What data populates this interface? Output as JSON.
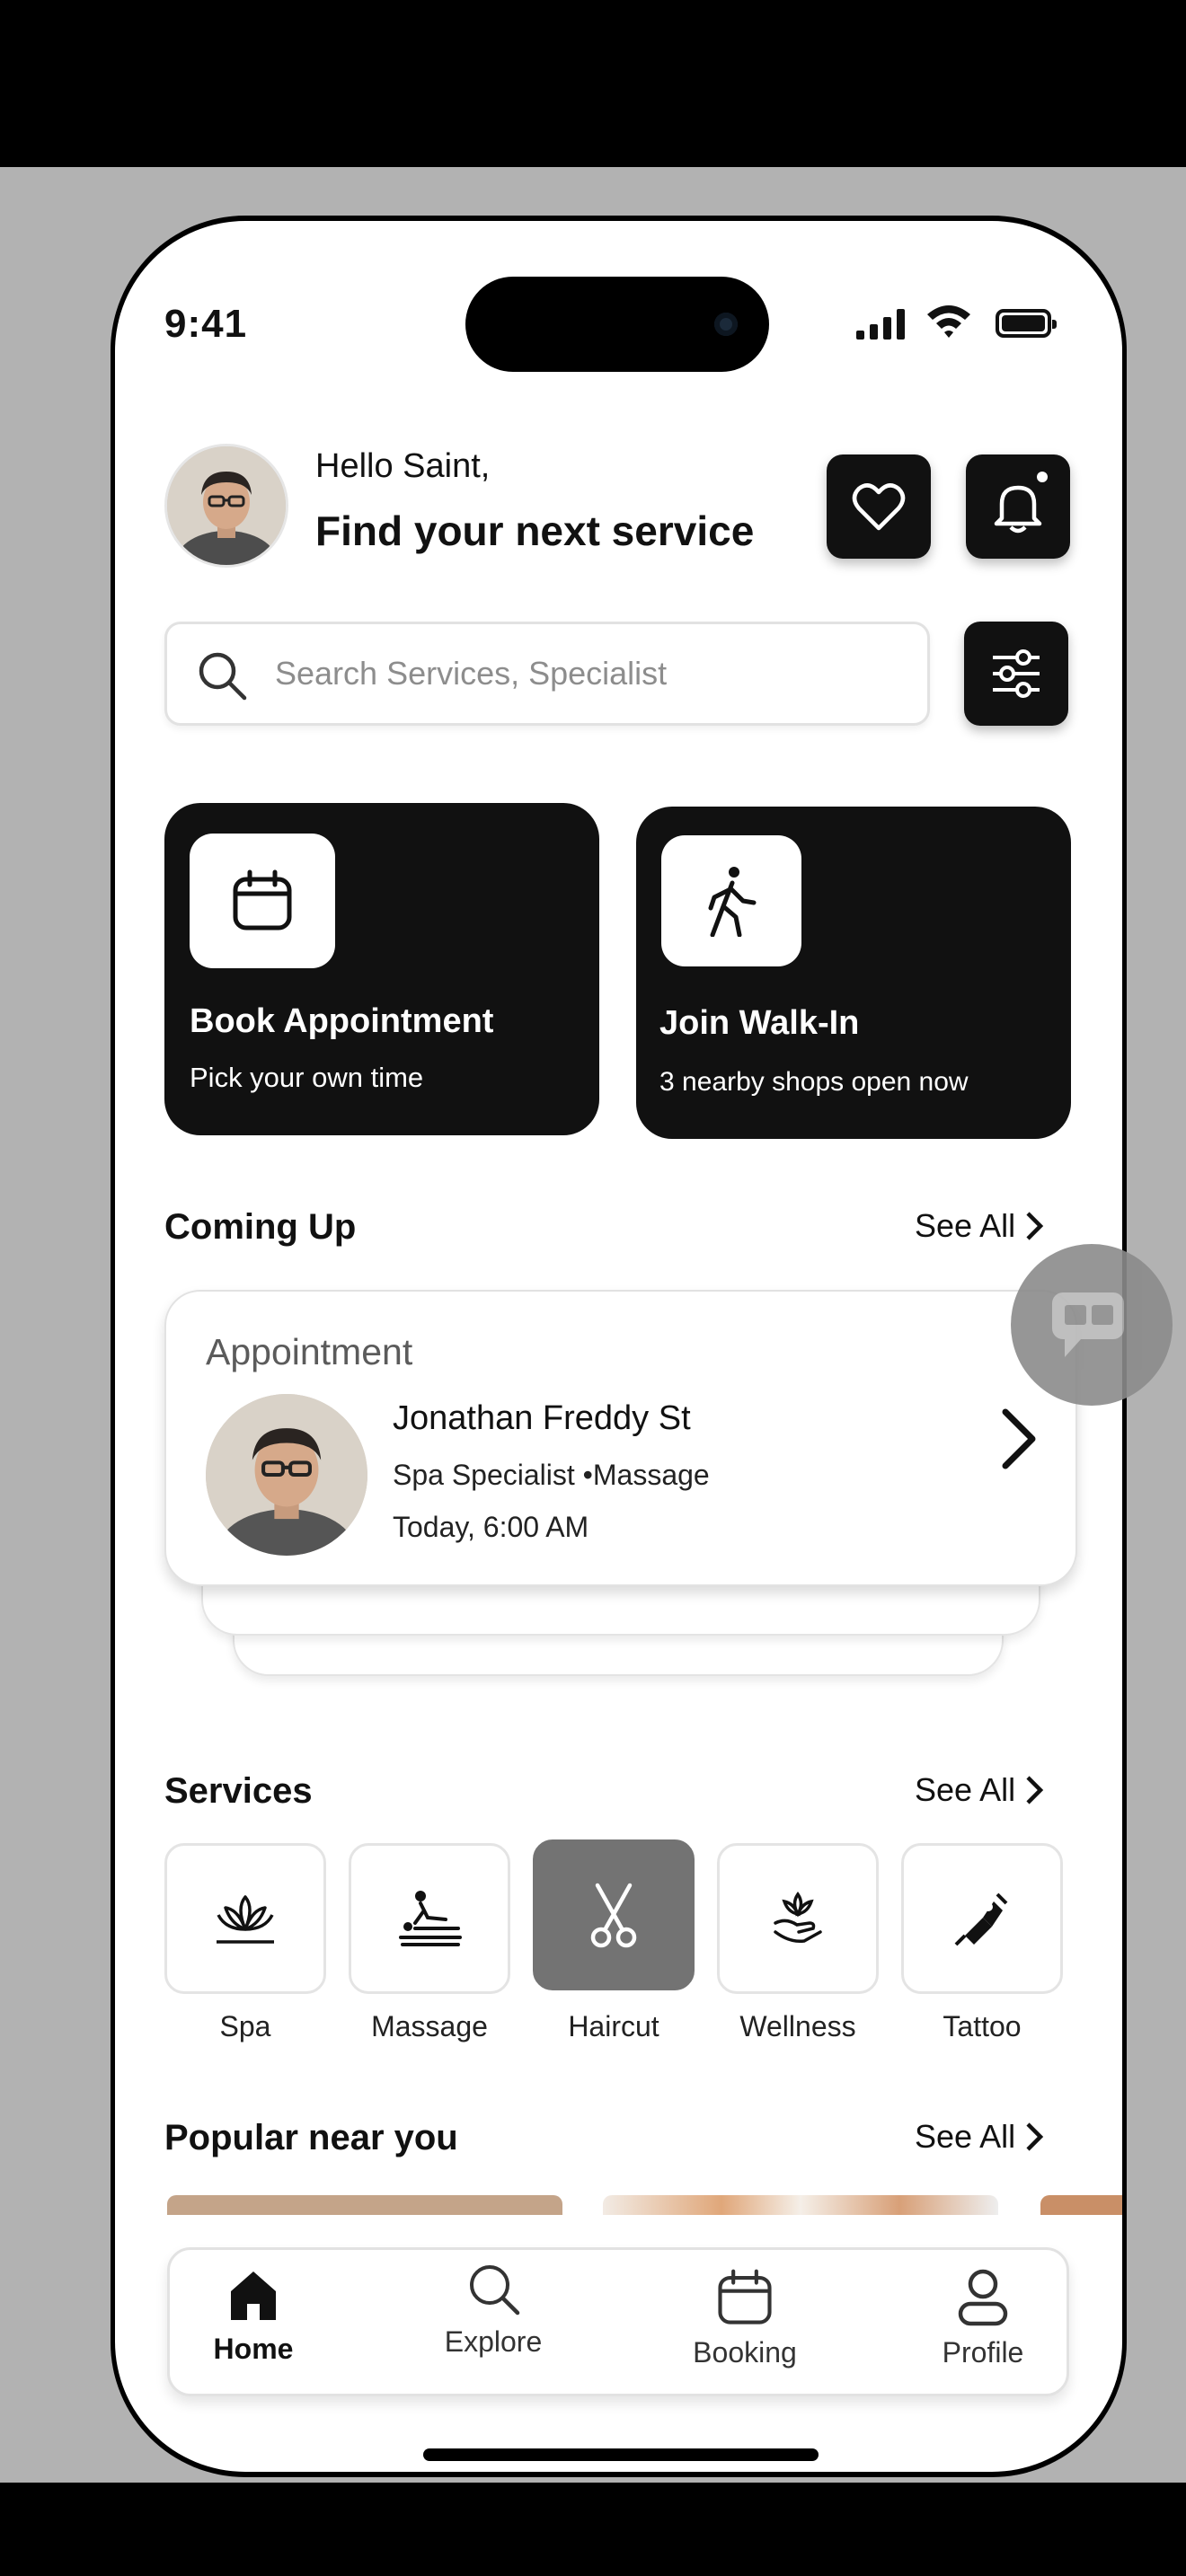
{
  "status_bar": {
    "time": "9:41"
  },
  "header": {
    "greeting": "Hello Saint,",
    "headline": "Find your next service"
  },
  "search": {
    "placeholder": "Search Services, Specialist"
  },
  "actions": [
    {
      "title": "Book Appointment",
      "subtitle": "Pick your own time",
      "icon": "calendar-icon"
    },
    {
      "title": "Join Walk-In",
      "subtitle": "3 nearby shops open now",
      "icon": "walking-person-icon"
    }
  ],
  "coming_up": {
    "title": "Coming Up",
    "see_all": "See All",
    "appointment": {
      "label": "Appointment",
      "name": "Jonathan Freddy St",
      "detail": "Spa Specialist •Massage",
      "time": "Today, 6:00 AM"
    }
  },
  "services": {
    "title": "Services",
    "see_all": "See All",
    "items": [
      {
        "label": "Spa",
        "icon": "lotus-icon",
        "active": false
      },
      {
        "label": "Massage",
        "icon": "massage-icon",
        "active": false
      },
      {
        "label": "Haircut",
        "icon": "scissors-icon",
        "active": true
      },
      {
        "label": "Wellness",
        "icon": "wellness-hand-icon",
        "active": false
      },
      {
        "label": "Tattoo",
        "icon": "tattoo-machine-icon",
        "active": false
      }
    ]
  },
  "popular": {
    "title": "Popular near you",
    "see_all": "See All"
  },
  "tabbar": {
    "items": [
      {
        "label": "Home",
        "icon": "home-icon",
        "active": true
      },
      {
        "label": "Explore",
        "icon": "search-icon",
        "active": false
      },
      {
        "label": "Booking",
        "icon": "calendar-icon",
        "active": false
      },
      {
        "label": "Profile",
        "icon": "profile-icon",
        "active": false
      }
    ]
  },
  "colors": {
    "accent": "#111111",
    "active_service": "#737373",
    "backdrop": "#b2b2b2"
  }
}
